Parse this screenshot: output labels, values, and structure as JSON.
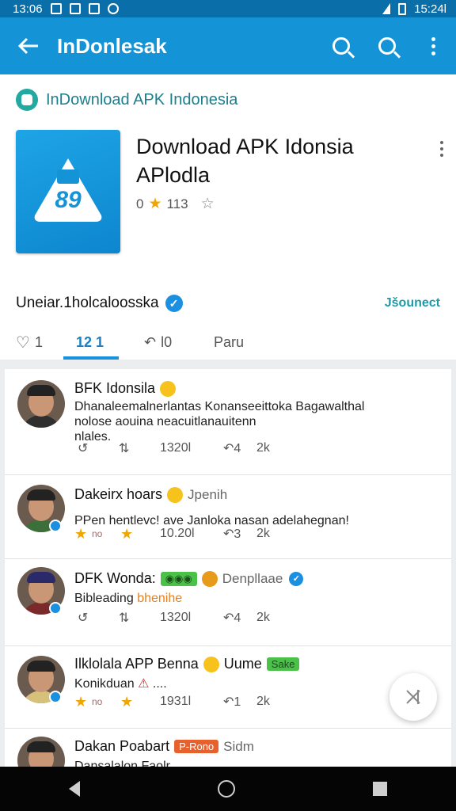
{
  "status_bar": {
    "time_left": "13:06",
    "time_right": "15:24l"
  },
  "app_bar": {
    "title": "InDonlesak"
  },
  "header": {
    "breadcrumb": "InDownload APK Indonesia",
    "app_name_line1": "Download APK Idonsia",
    "app_name_line2": "APlodla",
    "rating_value": "0",
    "rating_count": "113",
    "publisher": "Uneiar.1holcaloosska",
    "publisher_action": "Jšounect",
    "tabs": [
      {
        "label": "1"
      },
      {
        "label": "12 1"
      },
      {
        "label": "l0"
      },
      {
        "label": "Paru"
      }
    ]
  },
  "posts": [
    {
      "name": "BFK Idonsila",
      "text_line1": "Dhanaleemalnerlantas Konanseeittoka Bagawalthal",
      "text_line2": "nolose aouina neacuitlanauitenn",
      "text_line3": "nlales.",
      "action_reply": "",
      "action_time": "1320l",
      "action_count": "2k"
    },
    {
      "name": "Dakeirx hoars",
      "sub": "Jpenih",
      "text_line1": "PPen hentlevc! ave Janloka nasan adelahegnan!",
      "action_time": "10.20l",
      "action_count": "2k"
    },
    {
      "name": "DFK Wonda:",
      "sub": "Denpllaae",
      "text_line1": "Bibleading",
      "text_highlight": "bhenihe",
      "action_time": "1320l",
      "action_count": "2k"
    },
    {
      "name": "Ilklolala APP Benna",
      "sub": "Uume",
      "tag": "Sake",
      "text_line1": "Konikduan",
      "text_tail": "....",
      "action_time": "1931l",
      "action_count": "2k"
    },
    {
      "name": "Dakan Poabart",
      "tag": "P-Rono",
      "sub": "Sidm",
      "text_line1": "Dansalalon Faolr"
    }
  ],
  "icons": {
    "back": "arrow-left-icon",
    "search": "search-icon",
    "more": "more-vert-icon",
    "fab": "close-icon"
  },
  "colors": {
    "primary": "#1493d6",
    "accent": "#1b8fe0",
    "star": "#f0a600"
  }
}
